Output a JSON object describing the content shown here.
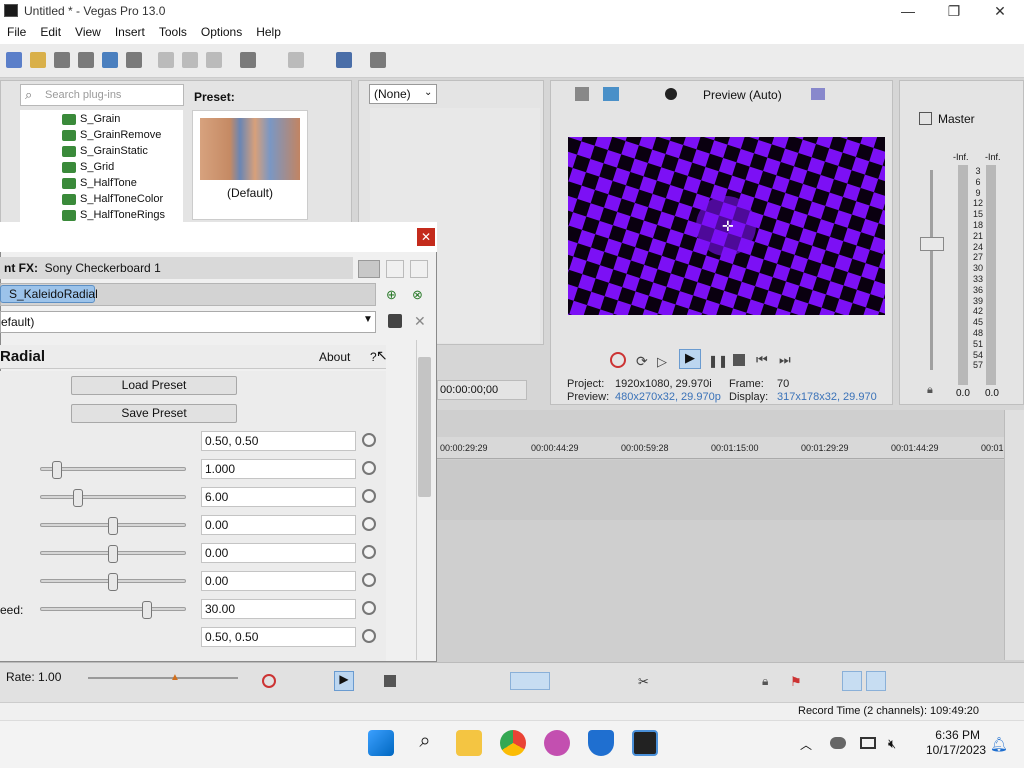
{
  "window": {
    "title": "Untitled * - Vegas Pro 13.0"
  },
  "menu": [
    "File",
    "Edit",
    "View",
    "Insert",
    "Tools",
    "Options",
    "Help"
  ],
  "plugins": {
    "search_placeholder": "Search plug-ins",
    "items": [
      "S_Grain",
      "S_GrainRemove",
      "S_GrainStatic",
      "S_Grid",
      "S_HalfTone",
      "S_HalfToneColor",
      "S_HalfToneRings"
    ],
    "preset_label": "Preset:",
    "preset_default": "(Default)"
  },
  "fx_selector": {
    "value": "(None)"
  },
  "preview": {
    "mode": "Preview (Auto)",
    "timecode": "00:00:00;00",
    "info": {
      "project_label": "Project:",
      "project": "1920x1080, 29.970i",
      "frame_label": "Frame:",
      "frame": "70",
      "preview_label": "Preview:",
      "preview": "480x270x32, 29.970p",
      "display_label": "Display:",
      "display": "317x178x32, 29.970"
    }
  },
  "master": {
    "label": "Master",
    "scale": [
      "3",
      "6",
      "9",
      "12",
      "15",
      "18",
      "21",
      "24",
      "27",
      "30",
      "33",
      "36",
      "39",
      "42",
      "45",
      "48",
      "51",
      "54",
      "57"
    ],
    "inf_left": "-Inf.",
    "inf_right": "-Inf.",
    "val_left": "0.0",
    "val_right": "0.0"
  },
  "timeline": {
    "ticks": [
      "00:00:29:29",
      "00:00:44:29",
      "00:00:59:28",
      "00:01:15:00",
      "00:01:29:29",
      "00:01:44:29",
      "00:01:"
    ]
  },
  "dialog": {
    "fx_label": "nt FX:",
    "fx_name": "Sony Checkerboard 1",
    "chain_item": "S_KaleidoRadial",
    "preset_value": "efault)",
    "plugin_name": "Radial",
    "about": "About",
    "help": "?",
    "load_preset": "Load Preset",
    "save_preset": "Save Preset",
    "params": [
      {
        "value": "0.50, 0.50",
        "slider": null
      },
      {
        "value": "1.000",
        "slider": 0.08
      },
      {
        "value": "6.00",
        "slider": 0.24
      },
      {
        "value": "0.00",
        "slider": 0.5
      },
      {
        "value": "0.00",
        "slider": 0.5
      },
      {
        "value": "0.00",
        "slider": 0.5
      },
      {
        "value": "30.00",
        "slider": 0.75,
        "label": "eed:"
      },
      {
        "value": "0.50, 0.50",
        "slider": null
      }
    ]
  },
  "transport": {
    "rate": "Rate: 1.00"
  },
  "status": {
    "record_time": "Record Time (2 channels): 109:49:20"
  },
  "taskbar": {
    "time": "6:36 PM",
    "date": "10/17/2023"
  }
}
